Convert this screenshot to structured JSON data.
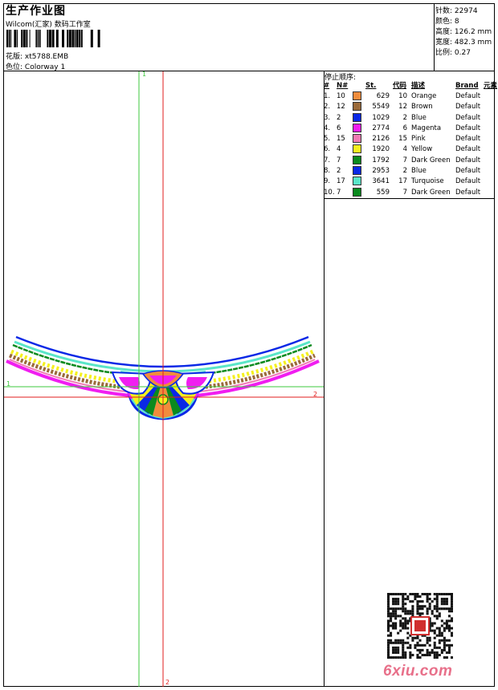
{
  "header": {
    "title": "生产作业图",
    "studio": "Wilcom(汇家) 数码工作室",
    "design_label": "花版:",
    "design_value": "xt5788.EMB",
    "colorway_label": "色位:",
    "colorway_value": "Colorway 1"
  },
  "stats": {
    "stitches_label": "针数:",
    "stitches_value": "22974",
    "colors_label": "颜色:",
    "colors_value": "8",
    "height_label": "高度:",
    "height_value": "126.2 mm",
    "width_label": "宽度:",
    "width_value": "482.3 mm",
    "scale_label": "比例:",
    "scale_value": "0.27"
  },
  "stop_sequence": {
    "title": "停止顺序:",
    "headers": {
      "idx": "#",
      "n": "N#",
      "st": "St.",
      "code": "代码",
      "desc": "描述",
      "brand": "Brand",
      "element": "元素"
    },
    "rows": [
      {
        "idx": "1.",
        "n": "10",
        "st": "629",
        "code": "10",
        "desc": "Orange",
        "brand": "Default",
        "color": "#f08c3c"
      },
      {
        "idx": "2.",
        "n": "12",
        "st": "5549",
        "code": "12",
        "desc": "Brown",
        "brand": "Default",
        "color": "#9a6a3a"
      },
      {
        "idx": "3.",
        "n": "2",
        "st": "1029",
        "code": "2",
        "desc": "Blue",
        "brand": "Default",
        "color": "#0a28e6"
      },
      {
        "idx": "4.",
        "n": "6",
        "st": "2774",
        "code": "6",
        "desc": "Magenta",
        "brand": "Default",
        "color": "#f01ef0"
      },
      {
        "idx": "5.",
        "n": "15",
        "st": "2126",
        "code": "15",
        "desc": "Pink",
        "brand": "Default",
        "color": "#f07ab4"
      },
      {
        "idx": "6.",
        "n": "4",
        "st": "1920",
        "code": "4",
        "desc": "Yellow",
        "brand": "Default",
        "color": "#f5f01e"
      },
      {
        "idx": "7.",
        "n": "7",
        "st": "1792",
        "code": "7",
        "desc": "Dark Green",
        "brand": "Default",
        "color": "#0a8a1e"
      },
      {
        "idx": "8.",
        "n": "2",
        "st": "2953",
        "code": "2",
        "desc": "Blue",
        "brand": "Default",
        "color": "#0a28e6"
      },
      {
        "idx": "9.",
        "n": "17",
        "st": "3641",
        "code": "17",
        "desc": "Turquoise",
        "brand": "Default",
        "color": "#5ae6c8"
      },
      {
        "idx": "10.",
        "n": "7",
        "st": "559",
        "code": "7",
        "desc": "Dark Green",
        "brand": "Default",
        "color": "#0a8a1e"
      }
    ]
  },
  "canvas": {
    "axis_labels": {
      "green_top": "1",
      "green_left": "1",
      "red_right": "2",
      "red_bottom": "2"
    },
    "axis_colors": {
      "green": "#3cc83c",
      "red": "#e01e1e"
    }
  },
  "watermark": {
    "text": "6xiu.com",
    "color": "#e8708a",
    "seal_text": "印"
  }
}
